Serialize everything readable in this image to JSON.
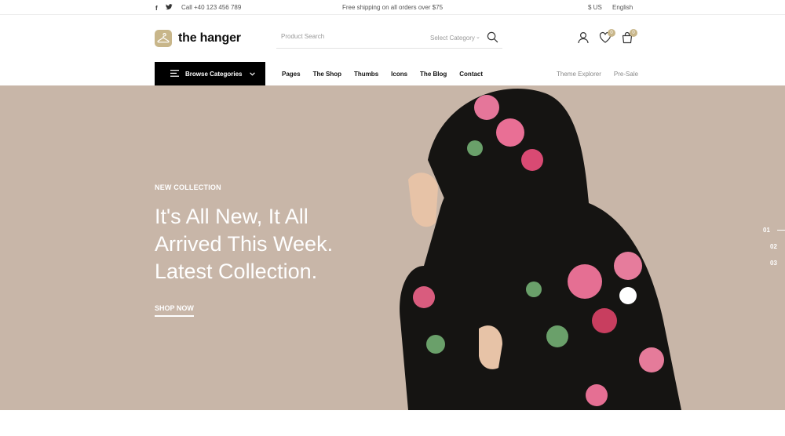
{
  "topbar": {
    "social": [
      {
        "icon": "facebook-icon",
        "glyph": "f"
      },
      {
        "icon": "twitter-icon",
        "glyph": "t"
      }
    ],
    "phone": "Call +40 123 456 789",
    "shipping": "Free shipping on all orders over $75",
    "currency": "$ US",
    "language": "English"
  },
  "header": {
    "logo_text": "the hanger",
    "search_placeholder": "Product Search",
    "category_label": "Select Category",
    "wishlist_count": "0",
    "cart_count": "0"
  },
  "nav": {
    "browse_label": "Browse Categories",
    "items": [
      "Pages",
      "The Shop",
      "Thumbs",
      "Icons",
      "The Blog",
      "Contact"
    ],
    "right_items": [
      "Theme Explorer",
      "Pre-Sale"
    ]
  },
  "hero": {
    "eyebrow": "NEW COLLECTION",
    "headline_lines": [
      "It's All New, It All",
      "Arrived This Week.",
      "Latest Collection."
    ],
    "cta": "SHOP NOW",
    "slides": [
      "01",
      "02",
      "03"
    ]
  },
  "colors": {
    "accent": "#c8b68a",
    "hero_bg": "#c8b6a8",
    "nav_dark": "#000000"
  }
}
